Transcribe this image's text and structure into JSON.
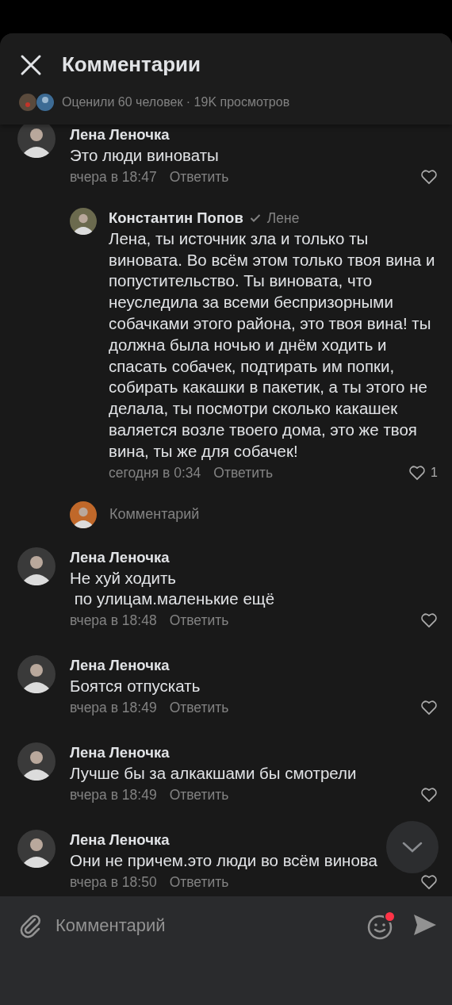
{
  "header": {
    "title": "Комментарии",
    "stats": "Оценили 60 человек · 19K просмотров"
  },
  "comments": [
    {
      "author": "Лена Леночка",
      "text": "Это люди виноваты",
      "time": "вчера в 18:47",
      "reply_label": "Ответить",
      "children": [
        {
          "author": "Константин Попов",
          "verified": true,
          "reply_to": "Лене",
          "text": "Лена, ты источник зла и только ты виновата. Во всём этом только твоя вина и попустительство. Ты виновата, что неуследила за всеми беспризорными собачками этого района, это твоя вина! ты должна была ночью и днём ходить и спасать собачек, подтирать им попки, собирать какашки в пакетик, а ты этого не делала, ты посмотри сколько какашек валяется возле твоего дома, это же твоя вина, ты же для собачек!",
          "time": "сегодня в 0:34",
          "reply_label": "Ответить",
          "likes": "1"
        }
      ],
      "reply_field": {
        "placeholder": "Комментарий"
      }
    },
    {
      "author": "Лена Леночка",
      "text": "Не хуй ходить\n по улицам.маленькие ещё",
      "time": "вчера в 18:48",
      "reply_label": "Ответить"
    },
    {
      "author": "Лена Леночка",
      "text": "Боятся отпускать",
      "time": "вчера в 18:49",
      "reply_label": "Ответить"
    },
    {
      "author": "Лена Леночка",
      "text": "Лучше бы за алкакшами бы смотрели",
      "time": "вчера в 18:49",
      "reply_label": "Ответить"
    },
    {
      "author": "Лена Леночка",
      "text": "Они не причем.это люди во всём винова",
      "time": "вчера в 18:50",
      "reply_label": "Ответить"
    }
  ],
  "composer": {
    "placeholder": "Комментарий",
    "emoji_notification": true
  }
}
